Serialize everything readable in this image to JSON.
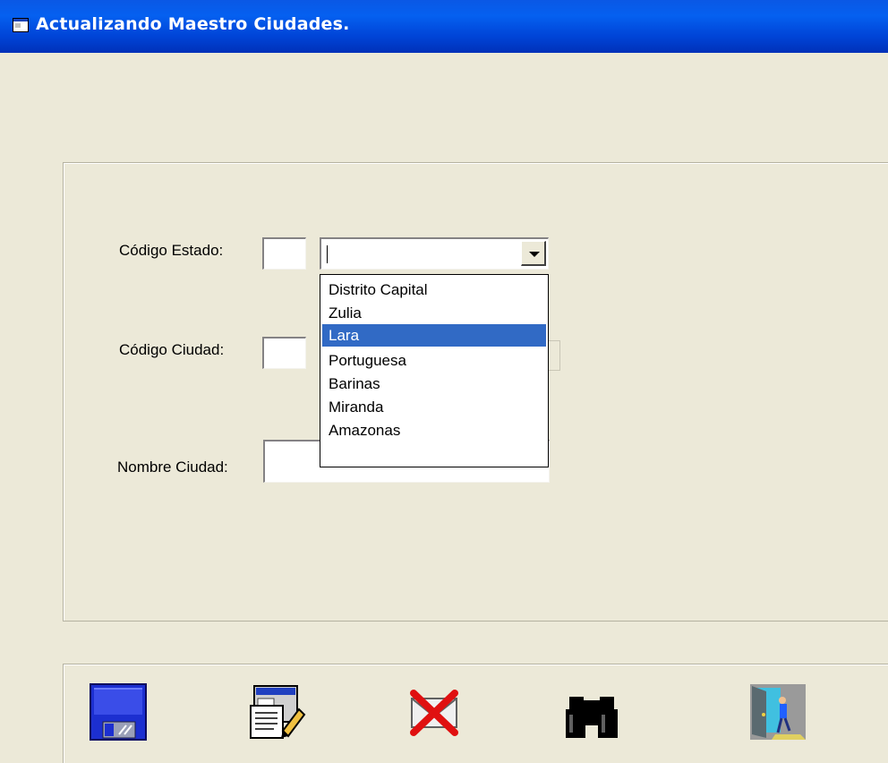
{
  "window": {
    "title": "Actualizando Maestro Ciudades.",
    "icon": "window-icon"
  },
  "form": {
    "codigo_estado_label": "Código Estado:",
    "codigo_ciudad_label": "Código Ciudad:",
    "nombre_ciudad_label": "Nombre Ciudad:",
    "codigo_estado_value": "",
    "codigo_ciudad_value": "",
    "nombre_ciudad_value": "",
    "estado_combo_value": ""
  },
  "dropdown": {
    "items": [
      "Distrito Capital",
      "Zulia",
      "Lara",
      "Portuguesa",
      "Barinas",
      "Miranda",
      "Amazonas"
    ],
    "selected_index": 2
  },
  "toolbar": {
    "buttons": [
      {
        "icon": "floppy-disk-icon",
        "action": "save"
      },
      {
        "icon": "edit-document-icon",
        "action": "edit"
      },
      {
        "icon": "delete-envelope-icon",
        "action": "delete"
      },
      {
        "icon": "binoculars-icon",
        "action": "search"
      },
      {
        "icon": "exit-door-icon",
        "action": "exit"
      }
    ]
  },
  "colors": {
    "titlebar": "#0054e3",
    "window_bg": "#ece9d8",
    "selection": "#316ac5"
  }
}
